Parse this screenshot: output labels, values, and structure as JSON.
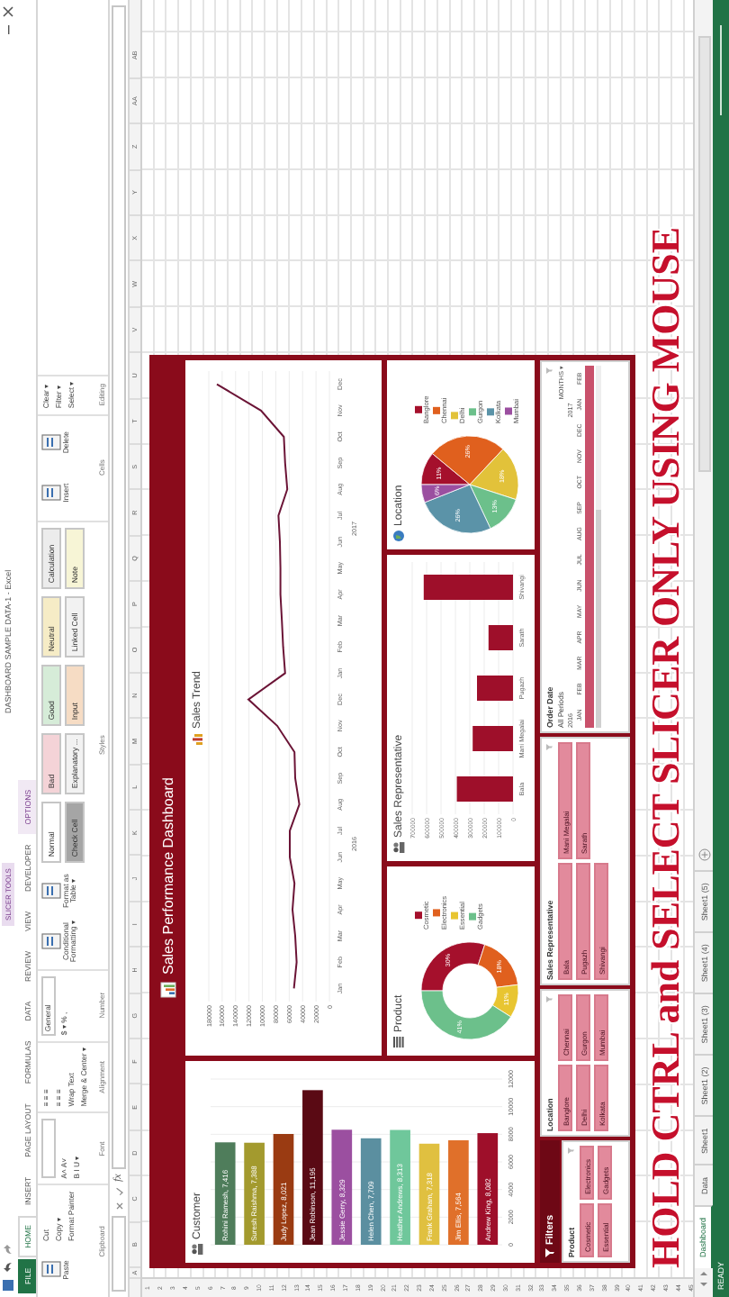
{
  "title_bar": {
    "title": "DASHBOARD SAMPLE DATA-1 - Excel",
    "context_tab": "SLICER TOOLS"
  },
  "ribbon_tabs": [
    {
      "label": "FILE",
      "kind": "file",
      "selected": false
    },
    {
      "label": "HOME",
      "kind": "tab",
      "selected": true
    },
    {
      "label": "INSERT",
      "kind": "tab",
      "selected": false
    },
    {
      "label": "PAGE LAYOUT",
      "kind": "tab",
      "selected": false
    },
    {
      "label": "FORMULAS",
      "kind": "tab",
      "selected": false
    },
    {
      "label": "DATA",
      "kind": "tab",
      "selected": false
    },
    {
      "label": "REVIEW",
      "kind": "tab",
      "selected": false
    },
    {
      "label": "VIEW",
      "kind": "tab",
      "selected": false
    },
    {
      "label": "DEVELOPER",
      "kind": "tab",
      "selected": false
    },
    {
      "label": "OPTIONS",
      "kind": "context",
      "selected": false
    }
  ],
  "ribbon_groups": [
    {
      "label": "Clipboard",
      "items": [
        {
          "kind": "large",
          "label": "Paste"
        },
        {
          "kind": "small",
          "label": "Cut"
        },
        {
          "kind": "small",
          "label": "Copy ▾"
        },
        {
          "kind": "small",
          "label": "Format Painter"
        }
      ]
    },
    {
      "label": "Font",
      "items": [
        {
          "kind": "field"
        },
        {
          "kind": "small",
          "label": "A˄ A˅"
        },
        {
          "kind": "small",
          "label": "B  I  U ▾"
        }
      ]
    },
    {
      "label": "Alignment",
      "items": [
        {
          "kind": "small",
          "label": "≡ ≡ ≡"
        },
        {
          "kind": "small",
          "label": "≡ ≡ ≡"
        },
        {
          "kind": "small",
          "label": "Wrap Text"
        },
        {
          "kind": "small",
          "label": "Merge & Center ▾"
        }
      ]
    },
    {
      "label": "Number",
      "items": [
        {
          "kind": "field",
          "value": "General"
        },
        {
          "kind": "small",
          "label": "$ ▾ % ,"
        }
      ]
    },
    {
      "label": "Styles",
      "items": [
        {
          "kind": "large",
          "label": "Conditional Formatting ▾"
        },
        {
          "kind": "large",
          "label": "Format as Table ▾"
        },
        {
          "kind": "style",
          "label": "Normal",
          "color": "#ffffff"
        },
        {
          "kind": "style",
          "label": "Check Cell",
          "color": "#a5a5a5"
        },
        {
          "kind": "style",
          "label": "Bad",
          "color": "#f4d3d7"
        },
        {
          "kind": "style",
          "label": "Explanatory ...",
          "color": "#f2f2f2"
        },
        {
          "kind": "style",
          "label": "Good",
          "color": "#d6ecd8"
        },
        {
          "kind": "style",
          "label": "Input",
          "color": "#f6dcc4"
        },
        {
          "kind": "style",
          "label": "Neutral",
          "color": "#f6ecc6"
        },
        {
          "kind": "style",
          "label": "Linked Cell",
          "color": "#f2f2f2"
        },
        {
          "kind": "style",
          "label": "Calculation",
          "color": "#ececec"
        },
        {
          "kind": "style",
          "label": "Note",
          "color": "#f7f5d6"
        }
      ]
    },
    {
      "label": "Cells",
      "items": [
        {
          "kind": "large",
          "label": "Insert"
        },
        {
          "kind": "large",
          "label": "Delete"
        }
      ]
    },
    {
      "label": "Editing",
      "items": [
        {
          "kind": "small",
          "label": "Clear ▾"
        },
        {
          "kind": "small",
          "label": "Filter ▾"
        },
        {
          "kind": "small",
          "label": "Select ▾"
        }
      ]
    }
  ],
  "formula_bar": {
    "function_label": "fx"
  },
  "columns": [
    "A",
    "B",
    "C",
    "D",
    "E",
    "F",
    "G",
    "H",
    "I",
    "J",
    "K",
    "L",
    "M",
    "N",
    "O",
    "P",
    "Q",
    "R",
    "S",
    "T",
    "U",
    "V",
    "W",
    "X",
    "Y",
    "Z",
    "AA",
    "AB"
  ],
  "rows": [
    "1",
    "2",
    "3",
    "4",
    "5",
    "6",
    "7",
    "8",
    "9",
    "10",
    "11",
    "12",
    "13",
    "14",
    "15",
    "16",
    "17",
    "18",
    "19",
    "20",
    "21",
    "22",
    "23",
    "24",
    "25",
    "26",
    "27",
    "28",
    "29",
    "30",
    "31",
    "32",
    "33",
    "34",
    "35",
    "36",
    "37",
    "38",
    "39",
    "40",
    "41",
    "42",
    "43",
    "44",
    "45"
  ],
  "dashboard": {
    "title": "Sales Performance Dashboard",
    "customer": {
      "chart_data": {
        "type": "bar",
        "orientation": "vertical",
        "title": "Customer",
        "categories": [
          "Rohini Ramesh, 7,416",
          "Suresh Raishma, 7,388",
          "Judy Lopez, 8,021",
          "Jean Robinson, 11,195",
          "Jessie Gerry, 8,329",
          "Helen Chen, 7,709",
          "Heather Andrews, 8,313",
          "Frank Graham, 7,318",
          "Jim Ellis, 7,564",
          "Andrew King, 8,082"
        ],
        "values": [
          7416,
          7388,
          8021,
          11195,
          8329,
          7709,
          8313,
          7318,
          7564,
          8082
        ],
        "ylim": [
          0,
          12000
        ],
        "yticks": [
          0,
          2000,
          4000,
          6000,
          8000,
          10000,
          12000
        ],
        "grid": true
      }
    },
    "trend": {
      "chart_data": {
        "type": "line",
        "orientation": "horizontal",
        "title": "Sales Trend",
        "categories": [
          "Dec",
          "Nov",
          "Oct",
          "Sep",
          "Aug",
          "Jul",
          "Jun",
          "May",
          "Apr",
          "Mar",
          "Feb",
          "Jan",
          "Dec",
          "Nov",
          "Oct",
          "Sep",
          "Aug",
          "Jul",
          "Jun",
          "May",
          "Apr",
          "Mar",
          "Feb",
          "Jan"
        ],
        "series": [
          {
            "color": "#6b1436",
            "values": [
              168000,
              102000,
              68000,
              66000,
              63000,
              76000,
              74000,
              73000,
              73000,
              71000,
              69000,
              66000,
              121000,
              78000,
              52000,
              51000,
              45000,
              59000,
              59000,
              52000,
              55000,
              51000,
              49000,
              53000
            ]
          }
        ],
        "xlim": [
          180000,
          0
        ],
        "xticks": [
          180000,
          160000,
          140000,
          120000,
          100000,
          80000,
          60000,
          40000,
          20000,
          0
        ],
        "grid": true,
        "annotations": [
          "2017",
          "2016"
        ]
      }
    },
    "product": {
      "chart_data": {
        "type": "donut",
        "title": "Product",
        "categories": [
          "Cosmetic",
          "Electronics",
          "Essential",
          "Gadgets"
        ],
        "values": [
          30,
          18,
          11,
          41
        ],
        "value_labels": [
          "30%",
          "18%",
          "11%",
          "41%"
        ],
        "legend": "top"
      }
    },
    "sales_rep": {
      "chart_data": {
        "type": "bar",
        "orientation": "horizontal",
        "title": "Sales Representative",
        "categories": [
          "Shivangi",
          "Sarath",
          "Pugazh",
          "Mani Megalai",
          "Bala"
        ],
        "values": [
          620000,
          170000,
          250000,
          280000,
          390000
        ],
        "xlim": [
          700000,
          0
        ],
        "xticks": [
          700000,
          600000,
          500000,
          400000,
          300000,
          200000,
          100000,
          0
        ],
        "grid": true
      }
    },
    "location": {
      "chart_data": {
        "type": "pie",
        "title": "Location",
        "categories": [
          "Banglore",
          "Chennai",
          "Delhi",
          "Gurgon",
          "Kolkata",
          "Mumbai"
        ],
        "values": [
          11,
          26,
          18,
          13,
          26,
          6
        ],
        "value_labels": [
          "11%",
          "26%",
          "18%",
          "13%",
          "26%",
          "6%"
        ],
        "legend": "top"
      }
    }
  },
  "filters": {
    "title": "Filters",
    "slicers": [
      {
        "title": "Product",
        "items": [
          {
            "label": "Cosmetic",
            "selected": true
          },
          {
            "label": "Electronics",
            "selected": true
          },
          {
            "label": "Essential",
            "selected": true
          },
          {
            "label": "Gadgets",
            "selected": true
          }
        ]
      },
      {
        "title": "Location",
        "items": [
          {
            "label": "Banglore",
            "selected": true
          },
          {
            "label": "Chennai",
            "selected": true
          },
          {
            "label": "Delhi",
            "selected": true
          },
          {
            "label": "Gurgon",
            "selected": true
          },
          {
            "label": "Kolkata",
            "selected": true
          },
          {
            "label": "Mumbai",
            "selected": true
          }
        ]
      },
      {
        "title": "Sales Representative",
        "items": [
          {
            "label": "Bala",
            "selected": true
          },
          {
            "label": "Mani Megalai",
            "selected": true
          },
          {
            "label": "Pugazh",
            "selected": true
          },
          {
            "label": "Sarath",
            "selected": true
          },
          {
            "label": "Shivangi",
            "selected": true
          }
        ]
      }
    ],
    "timeline": {
      "title": "Order Date",
      "period": "All Periods",
      "unit": "MONTHS ▾",
      "years": [
        "2016",
        "2017"
      ],
      "months": [
        "JAN",
        "FEB",
        "MAR",
        "APR",
        "MAY",
        "JUN",
        "JUL",
        "AUG",
        "SEP",
        "OCT",
        "NOV",
        "DEC",
        "JAN",
        "FEB"
      ],
      "level": 1
    }
  },
  "caption": "HOLD CTRL and SELECT SLICER ONLY USING MOUSE",
  "sheet_tabs": [
    {
      "label": "Dashboard",
      "selected": true
    },
    {
      "label": "Data",
      "selected": false
    },
    {
      "label": "Sheet1",
      "selected": false
    },
    {
      "label": "Sheet1 (2)",
      "selected": false
    },
    {
      "label": "Sheet1 (3)",
      "selected": false
    },
    {
      "label": "Sheet1 (4)",
      "selected": false
    },
    {
      "label": "Sheet1 (5)",
      "selected": false
    }
  ],
  "status_bar": {
    "text": "READY"
  }
}
